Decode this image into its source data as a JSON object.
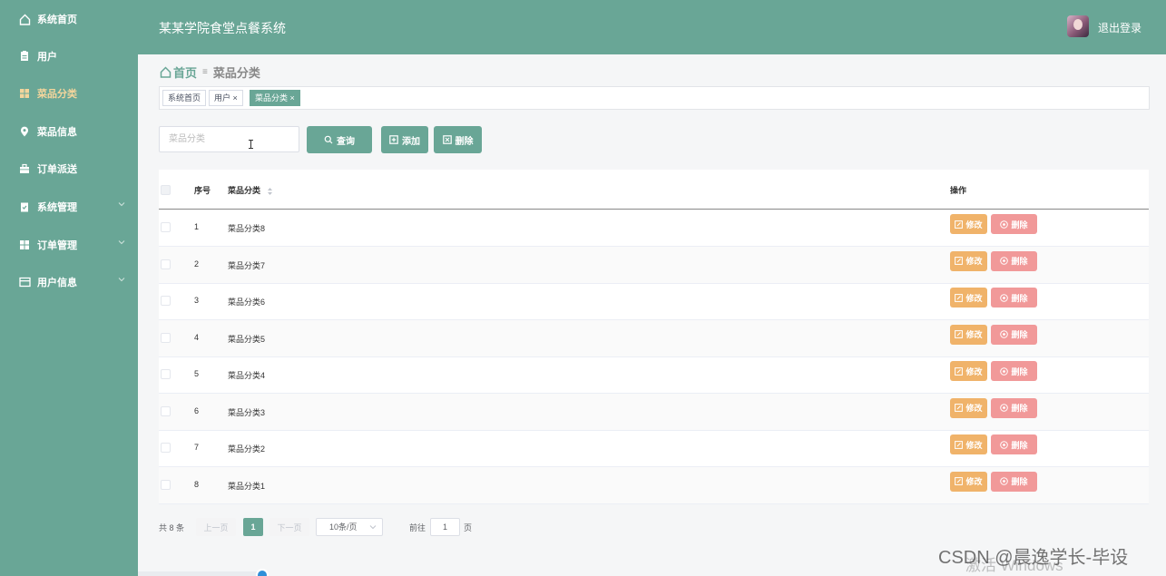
{
  "sidebar": {
    "items": [
      {
        "label": "系统首页",
        "icon": "home-icon",
        "has_submenu": false,
        "active": false
      },
      {
        "label": "用户",
        "icon": "document-icon",
        "has_submenu": false,
        "active": false
      },
      {
        "label": "菜品分类",
        "icon": "grid-icon",
        "has_submenu": false,
        "active": true
      },
      {
        "label": "菜品信息",
        "icon": "location-pin-icon",
        "has_submenu": false,
        "active": false
      },
      {
        "label": "订单派送",
        "icon": "briefcase-icon",
        "has_submenu": false,
        "active": false
      },
      {
        "label": "系统管理",
        "icon": "clipboard-icon",
        "has_submenu": true,
        "active": false
      },
      {
        "label": "订单管理",
        "icon": "grid-icon",
        "has_submenu": true,
        "active": false
      },
      {
        "label": "用户信息",
        "icon": "card-icon",
        "has_submenu": true,
        "active": false
      }
    ]
  },
  "header": {
    "title": "某某学院食堂点餐系统",
    "logout_label": "退出登录"
  },
  "breadcrumb": {
    "home": "首页",
    "current": "菜品分类"
  },
  "tags": [
    {
      "label": "系统首页",
      "closable": false,
      "active": false
    },
    {
      "label": "用户",
      "closable": true,
      "active": false
    },
    {
      "label": "菜品分类",
      "closable": true,
      "active": true
    }
  ],
  "search": {
    "placeholder": "菜品分类",
    "query_label": "查询",
    "add_label": "添加",
    "delete_label": "删除"
  },
  "table": {
    "columns": {
      "index": "序号",
      "category": "菜品分类",
      "actions": "操作"
    },
    "edit_label": "修改",
    "delete_label": "删除",
    "rows": [
      {
        "index": "1",
        "category": "菜品分类8"
      },
      {
        "index": "2",
        "category": "菜品分类7"
      },
      {
        "index": "3",
        "category": "菜品分类6"
      },
      {
        "index": "4",
        "category": "菜品分类5"
      },
      {
        "index": "5",
        "category": "菜品分类4"
      },
      {
        "index": "6",
        "category": "菜品分类3"
      },
      {
        "index": "7",
        "category": "菜品分类2"
      },
      {
        "index": "8",
        "category": "菜品分类1"
      }
    ]
  },
  "pagination": {
    "total": "共 8 条",
    "prev": "上一页",
    "current_page": "1",
    "next": "下一页",
    "page_size": "10条/页",
    "goto_label": "前往",
    "goto_value": "1",
    "page_unit": "页"
  },
  "watermarks": {
    "windows": "激活 Windows",
    "csdn": "CSDN @晨逸学长-毕设"
  },
  "colors": {
    "theme": "#69a696",
    "active_menu_text": "#f3d59c",
    "edit_button": "#f0b36a",
    "delete_button": "#f19999"
  }
}
